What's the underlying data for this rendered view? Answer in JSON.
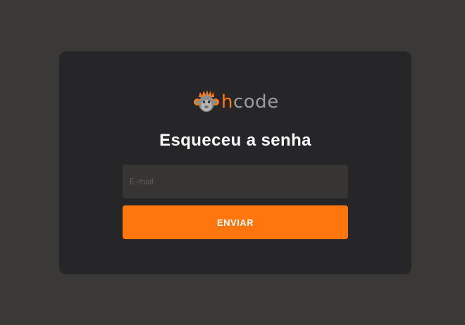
{
  "brand": {
    "logo_icon": "monkey-mascot-icon",
    "name_accent": "h",
    "name_rest": "code",
    "accent_color": "#ff7a0f"
  },
  "form": {
    "title": "Esqueceu a senha",
    "email_placeholder": "E-mail",
    "email_value": "",
    "submit_label": "ENVIAR"
  },
  "colors": {
    "background": "#3a3937",
    "card": "#262628",
    "input": "#363533",
    "button": "#ff760f"
  }
}
